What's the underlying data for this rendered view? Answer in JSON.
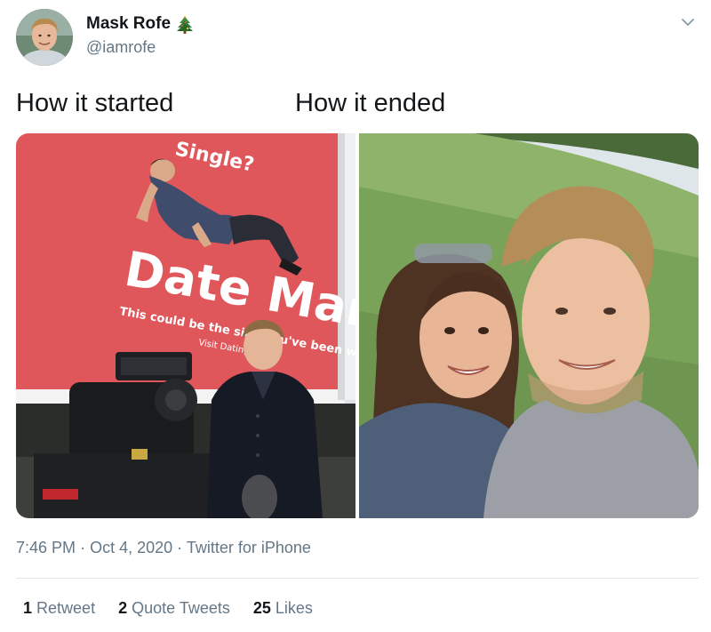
{
  "user": {
    "display_name": "Mask Rofe",
    "handle": "@iamrofe",
    "badge_icon": "christmas-tree-icon"
  },
  "tweet": {
    "caption_left": "How it started",
    "caption_right": "How it ended",
    "billboard": {
      "top_text": "Single?",
      "headline": "Date Mark",
      "subline": "This could be the sign you've been waiting for",
      "url_text": "Visit DatingMark"
    },
    "time": "7:46 PM",
    "date": "Oct 4, 2020",
    "source": "Twitter for iPhone",
    "sep": "·"
  },
  "stats": {
    "retweets_count": "1",
    "retweets_label": "Retweet",
    "quotes_count": "2",
    "quotes_label": "Quote Tweets",
    "likes_count": "25",
    "likes_label": "Likes"
  },
  "colors": {
    "billboard_red": "#e0575b",
    "text_primary": "#14171a",
    "text_secondary": "#657786"
  }
}
